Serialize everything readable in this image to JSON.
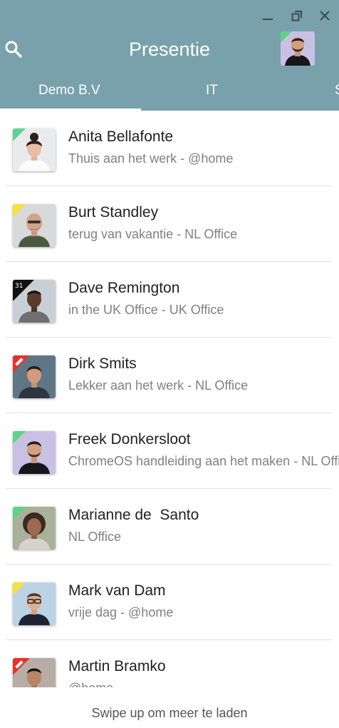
{
  "window": {
    "minimize_icon": "minimize-icon",
    "restore_icon": "restore-icon",
    "close_icon": "close-icon"
  },
  "header": {
    "title": "Presentie",
    "search_icon": "search-icon",
    "tabs": [
      {
        "label": "Demo B.V",
        "active": true
      },
      {
        "label": "IT",
        "active": false
      },
      {
        "label": "S",
        "active": false
      }
    ]
  },
  "colors": {
    "header_bg": "#78a1ab",
    "status_green": "#5fd38a",
    "status_yellow": "#f5e23a",
    "status_red": "#e8312b",
    "status_calendar": "#111111"
  },
  "contacts": [
    {
      "name": "Anita Bellafonte",
      "status": "Thuis aan het werk - @home",
      "indicator": "green"
    },
    {
      "name": "Burt Standley",
      "status": "terug van vakantie - NL Office",
      "indicator": "yellow"
    },
    {
      "name": "Dave Remington",
      "status": "in the UK Office - UK Office",
      "indicator": "calendar",
      "indicator_text": "31"
    },
    {
      "name": "Dirk Smits",
      "status": "Lekker aan het werk - NL Office",
      "indicator": "red"
    },
    {
      "name": "Freek Donkersloot",
      "status": "ChromeOS handleiding aan het maken - NL Office",
      "indicator": "green"
    },
    {
      "name": "Marianne de  Santo",
      "status": "NL Office",
      "indicator": "green"
    },
    {
      "name": "Mark van Dam",
      "status": "vrije dag - @home",
      "indicator": "yellow"
    },
    {
      "name": "Martin Bramko",
      "status": "@home",
      "indicator": "red"
    }
  ],
  "footer": {
    "hint": "Swipe up om meer te laden"
  }
}
